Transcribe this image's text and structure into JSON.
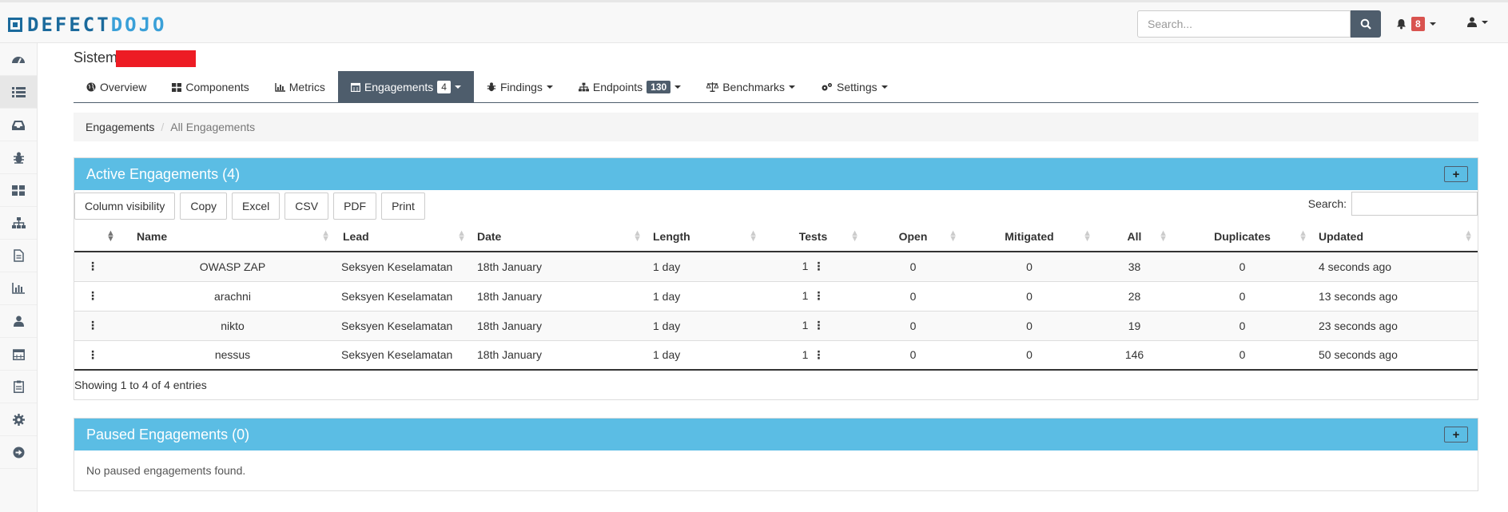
{
  "brand": {
    "logo_defect": "DEFECT",
    "logo_dojo": "DOJO",
    "primary": "#1b6a9c",
    "accent": "#3aa0d8"
  },
  "search": {
    "placeholder": "Search..."
  },
  "alerts": {
    "count": "8"
  },
  "sidebar": {
    "items": [
      "dashboard-icon",
      "list-icon",
      "inbox-icon",
      "bug-icon",
      "grid-icon",
      "sitemap-icon",
      "file-icon",
      "bar-chart-icon",
      "user-icon",
      "calendar-icon",
      "clipboard-icon",
      "gear-icon",
      "arrow-circle-right-icon"
    ]
  },
  "product": {
    "title": "Sistem"
  },
  "tabs": [
    {
      "label": "Overview"
    },
    {
      "label": "Components"
    },
    {
      "label": "Metrics"
    },
    {
      "label": "Engagements",
      "count": "4"
    },
    {
      "label": "Findings"
    },
    {
      "label": "Endpoints",
      "count": "130"
    },
    {
      "label": "Benchmarks"
    },
    {
      "label": "Settings"
    }
  ],
  "breadcrumb": {
    "root": "Engagements",
    "current": "All Engagements"
  },
  "active": {
    "title": "Active Engagements (4)",
    "buttons": [
      "Column visibility",
      "Copy",
      "Excel",
      "CSV",
      "PDF",
      "Print"
    ],
    "search_label": "Search:",
    "columns": [
      "Name",
      "Lead",
      "Date",
      "Length",
      "Tests",
      "Open",
      "Mitigated",
      "All",
      "Duplicates",
      "Updated"
    ],
    "rows": [
      {
        "name": "OWASP ZAP",
        "lead": "Seksyen Keselamatan",
        "date": "18th January",
        "length": "1 day",
        "tests": "1",
        "open": "0",
        "mitigated": "0",
        "all": "38",
        "duplicates": "0",
        "updated": "4 seconds ago"
      },
      {
        "name": "arachni",
        "lead": "Seksyen Keselamatan",
        "date": "18th January",
        "length": "1 day",
        "tests": "1",
        "open": "0",
        "mitigated": "0",
        "all": "28",
        "duplicates": "0",
        "updated": "13 seconds ago"
      },
      {
        "name": "nikto",
        "lead": "Seksyen Keselamatan",
        "date": "18th January",
        "length": "1 day",
        "tests": "1",
        "open": "0",
        "mitigated": "0",
        "all": "19",
        "duplicates": "0",
        "updated": "23 seconds ago"
      },
      {
        "name": "nessus",
        "lead": "Seksyen Keselamatan",
        "date": "18th January",
        "length": "1 day",
        "tests": "1",
        "open": "0",
        "mitigated": "0",
        "all": "146",
        "duplicates": "0",
        "updated": "50 seconds ago"
      }
    ],
    "info": "Showing 1 to 4 of 4 entries"
  },
  "paused": {
    "title": "Paused Engagements (0)",
    "empty": "No paused engagements found."
  }
}
